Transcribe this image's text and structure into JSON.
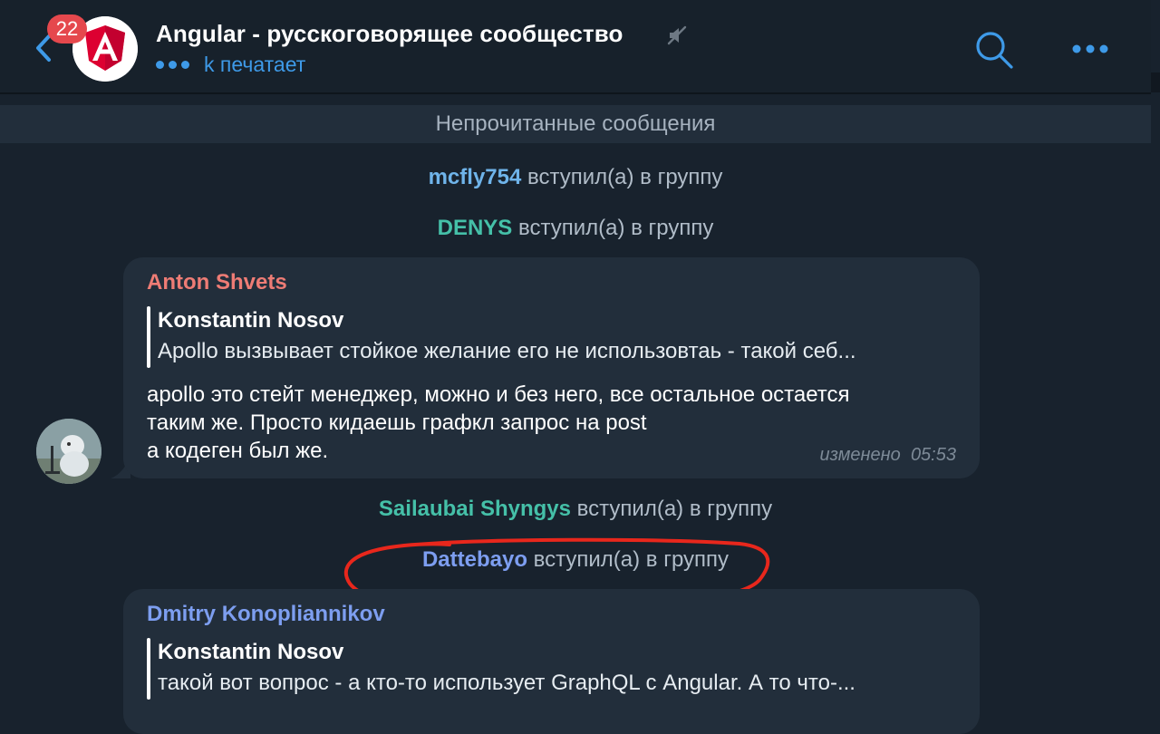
{
  "header": {
    "unread_count": "22",
    "title": "Angular - русскоговорящее сообщество",
    "typing_status": "k печатает"
  },
  "unread_divider": "Непрочитанные сообщения",
  "events": [
    {
      "name": "mcfly754",
      "text": "вступил(а) в группу",
      "name_color": "#6fb4ea"
    },
    {
      "name": "DENYS",
      "text": "вступил(а) в группу",
      "name_color": "#45c0a8"
    },
    {
      "name": "Sailaubai Shyngys",
      "text": "вступил(а) в группу",
      "name_color": "#45c0a8"
    },
    {
      "name": "Dattebayo",
      "text": "вступил(а) в группу",
      "name_color": "#7d9ef0"
    }
  ],
  "messages": [
    {
      "sender": "Anton Shvets",
      "sender_color": "#ee7c75",
      "reply_author": "Konstantin Nosov",
      "reply_text": "Apollo вызвывает стойкое желание его не использовтаь - такой себ...",
      "text": "apollo это стейт менеджер, можно и без него, все остальное остается\nтаким же. Просто кидаешь графкл запрос на post\nа кодеген был же.",
      "edited_label": "изменено",
      "time": "05:53"
    },
    {
      "sender": "Dmitry Konopliannikov",
      "sender_color": "#7d9ef0",
      "reply_author": "Konstantin Nosov",
      "reply_text": "такой вот вопрос - а кто-то использует GraphQL с Angular. А то что-..."
    }
  ],
  "colors": {
    "accent": "#3e9ae8",
    "background": "#18222d",
    "bubble": "#222e3b",
    "annotation": "#e8271c"
  },
  "icons": [
    "back-arrow-icon",
    "angular-logo-icon",
    "mute-icon",
    "search-icon",
    "more-icon"
  ]
}
